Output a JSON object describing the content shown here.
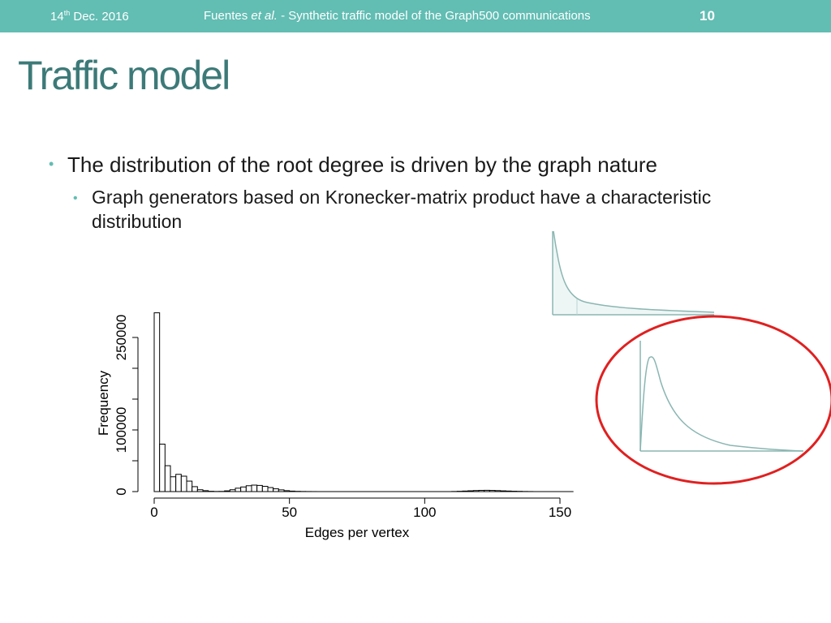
{
  "header": {
    "date_day": "14",
    "date_suffix": "th",
    "date_rest": " Dec. 2016",
    "author": "Fuentes ",
    "author_etal": "et al.",
    "talk_title": " - Synthetic traffic model of the Graph500 communications",
    "slide_number": "10"
  },
  "slide": {
    "title": "Traffic model",
    "bullet1": "The distribution of the root degree is driven by the graph nature",
    "bullet2": "Graph generators based on Kronecker-matrix product have a characteristic distribution"
  },
  "colors": {
    "accent": "#62bdb3",
    "title": "#3c7a78",
    "highlight_circle": "#e02020"
  },
  "chart_data": {
    "type": "bar",
    "xlabel": "Edges per vertex",
    "ylabel": "Frequency",
    "xlim": [
      0,
      155
    ],
    "ylim": [
      0,
      300000
    ],
    "xticks": [
      0,
      50,
      100,
      150
    ],
    "yticks": [
      0,
      50000,
      100000,
      150000,
      200000,
      250000
    ],
    "ytick_labels": [
      "0",
      "",
      "100000",
      "",
      "",
      "250000"
    ],
    "bin_width": 2,
    "bins_start": [
      0,
      2,
      4,
      6,
      8,
      10,
      12,
      14,
      16,
      18,
      20,
      22,
      24,
      26,
      28,
      30,
      32,
      34,
      36,
      38,
      40,
      42,
      44,
      46,
      48,
      50,
      52,
      54,
      56,
      58,
      110,
      112,
      114,
      116,
      118,
      120,
      122,
      124,
      126,
      128,
      130,
      132,
      134,
      136,
      138
    ],
    "values": [
      290000,
      77000,
      42000,
      24000,
      28000,
      25000,
      17000,
      8000,
      3000,
      1500,
      500,
      200,
      300,
      1200,
      3000,
      5500,
      7500,
      9500,
      10500,
      10000,
      8500,
      6500,
      4500,
      2800,
      1500,
      800,
      400,
      200,
      100,
      50,
      200,
      500,
      900,
      1300,
      1700,
      2000,
      2100,
      1900,
      1600,
      1200,
      900,
      600,
      400,
      200,
      100
    ]
  },
  "inset_shapes": [
    {
      "name": "power-law-sketch",
      "type": "line"
    },
    {
      "name": "peaked-sketch",
      "type": "line"
    }
  ]
}
